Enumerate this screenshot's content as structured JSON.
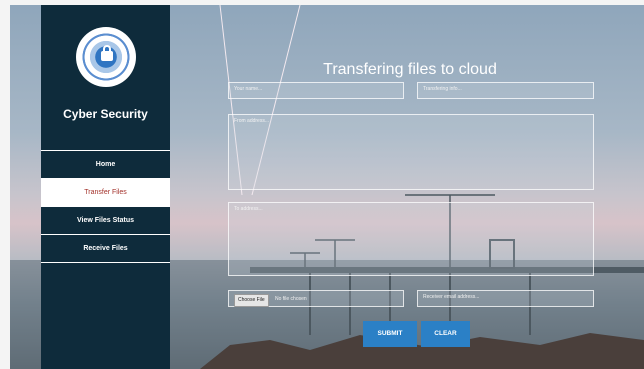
{
  "brand": {
    "name": "Cyber Security"
  },
  "nav": [
    {
      "label": "Home"
    },
    {
      "label": "Transfer Files",
      "active": true
    },
    {
      "label": "View Files Status"
    },
    {
      "label": "Receive Files"
    }
  ],
  "form": {
    "title": "Transfering files to cloud",
    "name_placeholder": "Your name...",
    "info_placeholder": "Transfering info...",
    "from_placeholder": "From address...",
    "to_placeholder": "To address...",
    "file_button": "Choose File",
    "file_status": "No file chosen",
    "email_placeholder": "Receiver email address...",
    "submit_label": "SUBMIT",
    "clear_label": "CLEAR"
  },
  "colors": {
    "sidebar": "#0e2b3b",
    "active_text": "#a3322b",
    "button": "#2b80c6"
  }
}
